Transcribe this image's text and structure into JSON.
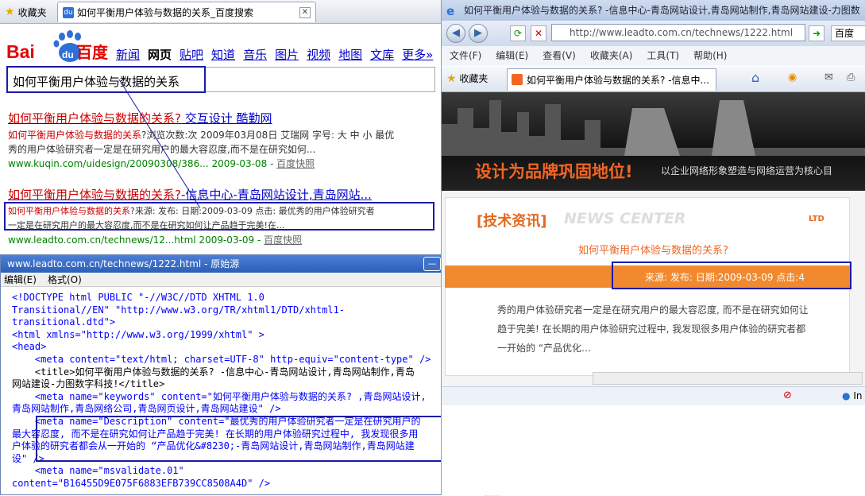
{
  "baidu": {
    "tab1": "收藏夹",
    "tab2": "如何平衡用户体验与数据的关系_百度搜索",
    "logo_bai": "Bai",
    "logo_du": "du",
    "logo_cn": "百度",
    "nav": [
      "新闻",
      "网页",
      "贴吧",
      "知道",
      "音乐",
      "图片",
      "视频",
      "地图",
      "文库",
      "更多»"
    ],
    "query": "如何平衡用户体验与数据的关系",
    "results": [
      {
        "title_hl": "如何平衡用户体验与数据的关系?",
        "title_rest": " 交互设计 酷勤网",
        "body1_hl": "如何平衡用户体验与数据的关系",
        "body1_rest": "?浏览次数:次 2009年03月08日 艾瑞网 字号: 大 中 小 最优",
        "body2": "秀的用户体验研究者一定是在研究用户的最大容忍度,而不是在研究如何...",
        "url": "www.kuqin.com/uidesign/20090308/386... 2009-03-08 - ",
        "snap": "百度快照"
      },
      {
        "title_hl": "如何平衡用户体验与数据的关系?",
        "title_rest": "-信息中心-青岛网站设计,青岛网站...",
        "body1_hl": "如何平衡用户体验与数据的关系",
        "body1_rest": "?来源: 发布: 日期:2009-03-09 点击: 最优秀的用户体验研究者",
        "body2": "一定是在研究用户的最大容忍度,而不是在研究如何让产品趋于完美!在...",
        "url": "www.leadto.com.cn/technews/12...html 2009-03-09 - ",
        "snap": "百度快照"
      }
    ]
  },
  "source": {
    "title": "www.leadto.com.cn/technews/1222.html - 原始源",
    "menu": [
      "编辑(E)",
      "格式(O)"
    ],
    "lines": [
      "<!DOCTYPE html PUBLIC \"-//W3C//DTD XHTML 1.0",
      "Transitional//EN\" \"http://www.w3.org/TR/xhtml1/DTD/xhtml1-",
      "transitional.dtd\">",
      "<html xmlns=\"http://www.w3.org/1999/xhtml\" >",
      "<head>",
      "    <meta content=\"text/html; charset=UTF-8\" http-equiv=\"content-type\" />",
      "    <title>如何平衡用户体验与数据的关系? -信息中心-青岛网站设计,青岛网站制作,青岛",
      "网站建设-力图数字科技!</title>",
      "    <meta name=\"keywords\" content=\"如何平衡用户体验与数据的关系? ,青岛网站设计,",
      "青岛网站制作,青岛网络公司,青岛网页设计,青岛网站建设\" />",
      "    <meta name=\"Description\" content=\"最优秀的用户体验研究者一定是在研究用户的",
      "最大容忍度, 而不是在研究如何让产品趋于完美! 在长期的用户体验研究过程中, 我发现很多用",
      "户体验的研究者都会从一开始的 “产品优化&#8230;-青岛网站设计,青岛网站制作,青岛网站建",
      "设\" />",
      "    <meta name=\"msvalidate.01\"",
      "content=\"B16455D9E075F6883EFB739CC8508A4D\" />"
    ]
  },
  "ie": {
    "title": "如何平衡用户体验与数据的关系? -信息中心-青岛网站设计,青岛网站制作,青岛网站建设-力图数字",
    "url": "http://www.leadto.com.cn/technews/1222.html",
    "search_frag": "百度",
    "menu": [
      "文件(F)",
      "编辑(E)",
      "查看(V)",
      "收藏夹(A)",
      "工具(T)",
      "帮助(H)"
    ],
    "fav": "收藏夹",
    "tab": "如何平衡用户体验与数据的关系? -信息中...",
    "slogan": "设计为品牌巩固地位!",
    "slogan2": "以企业网络形象塑造与网络运营为核心目",
    "section": "[技术资讯]",
    "section_en": "NEWS CENTER",
    "ltd": "LTD",
    "article_title": "如何平衡用户体验与数据的关系?",
    "meta": "来源:    发布:    日期:2009-03-09  点击:4",
    "body": [
      "秀的用户体验研究者一定是在研究用户的最大容忍度, 而不是在研究如何让",
      "趋于完美! 在长期的用户体验研究过程中, 我发现很多用户体验的研究者都",
      "一开始的 “产品优化…"
    ],
    "status_frag": "In"
  }
}
